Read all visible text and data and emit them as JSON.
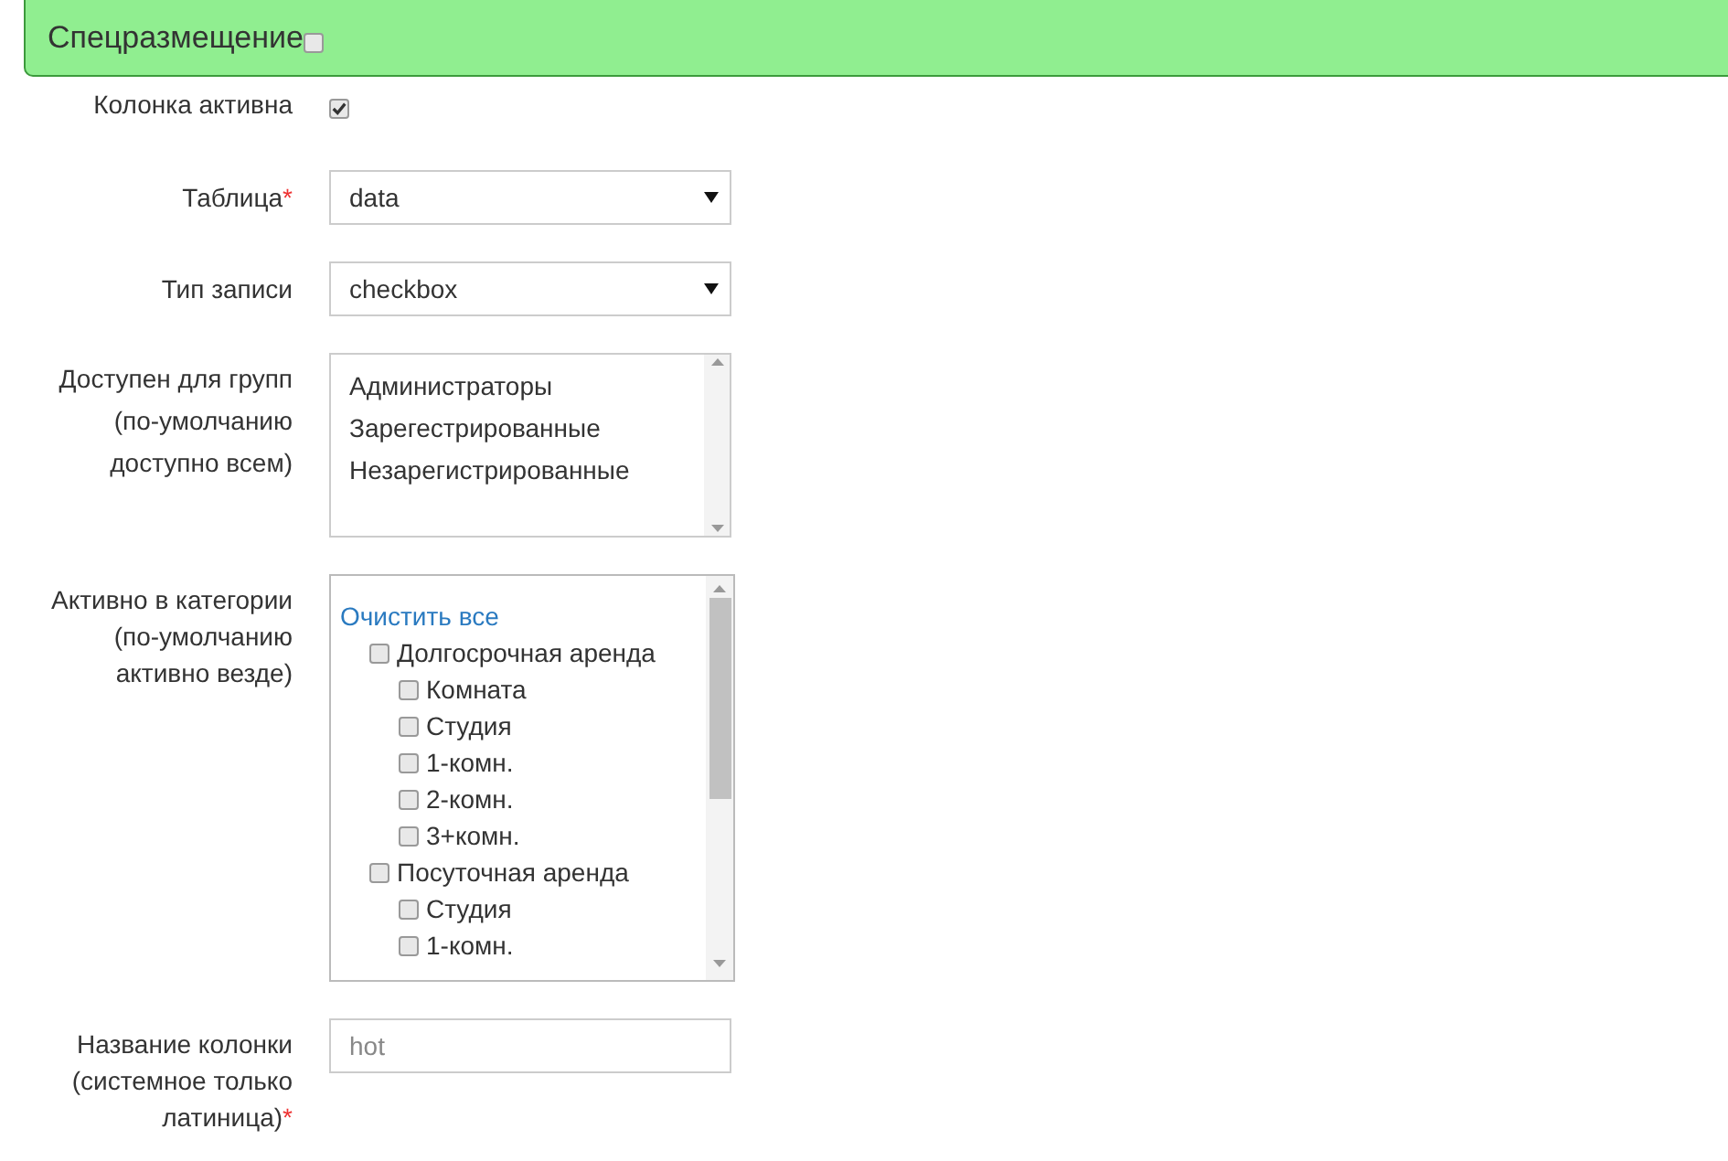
{
  "panel": {
    "title": "Спецразмещение",
    "checked": false
  },
  "fields": [
    {
      "kind": "checkbox",
      "label": "Колонка активна",
      "checked": true
    },
    {
      "kind": "select",
      "label": "Таблица",
      "required_mark": "*",
      "value": "data"
    },
    {
      "kind": "select",
      "label": "Тип записи",
      "value": "checkbox"
    },
    {
      "kind": "listbox",
      "label": "Доступен для групп (по-умолчанию доступно всем)",
      "options": [
        {
          "label": "Администраторы",
          "selected": false
        },
        {
          "label": "Зарегестрированные",
          "selected": false
        },
        {
          "label": "Незарегистрированные",
          "selected": false
        }
      ]
    },
    {
      "kind": "tree",
      "label": "Активно в категории (по-умолчанию активно везде)",
      "clear_link": "Очистить все",
      "items": [
        {
          "label": "Долгосрочная аренда",
          "checked": false,
          "children": [
            {
              "label": "Комната",
              "checked": false
            },
            {
              "label": "Студия",
              "checked": false
            },
            {
              "label": "1-комн.",
              "checked": false
            },
            {
              "label": "2-комн.",
              "checked": false
            },
            {
              "label": "3+комн.",
              "checked": false
            }
          ]
        },
        {
          "label": "Посуточная аренда",
          "checked": false,
          "children": [
            {
              "label": "Студия",
              "checked": false
            },
            {
              "label": "1-комн.",
              "checked": false
            }
          ]
        }
      ]
    },
    {
      "kind": "text",
      "label": "Название колонки (системное только латиница)",
      "required_mark": "*",
      "placeholder": "hot"
    }
  ]
}
